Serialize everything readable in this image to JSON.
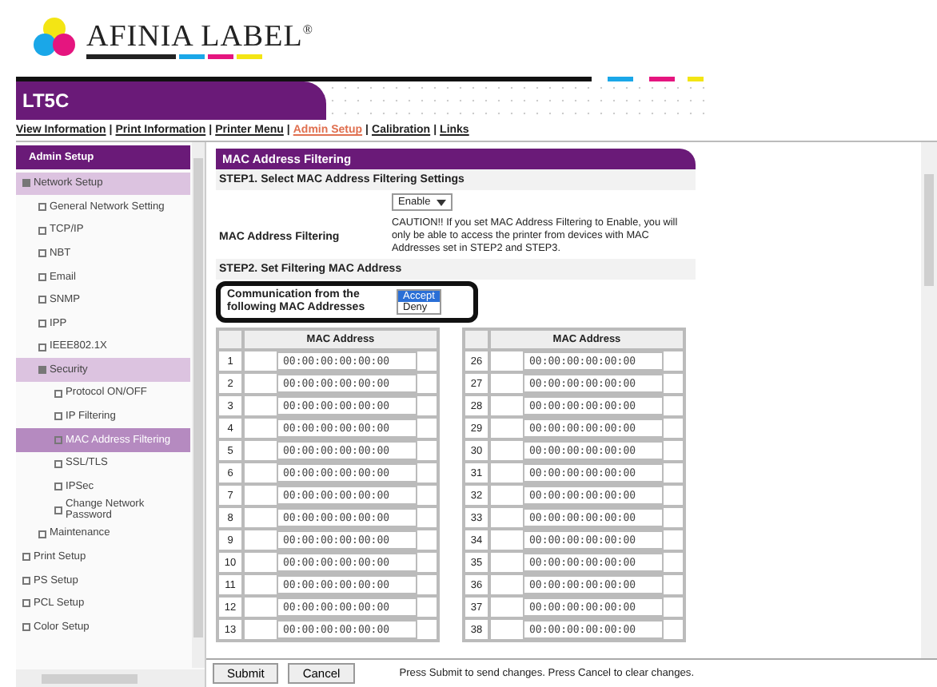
{
  "logo": {
    "text": "AFINIA LABEL$^{®}$"
  },
  "title_bar": {
    "title": "LT5C"
  },
  "nav": {
    "separator": "|",
    "links": [
      {
        "label": "View Information",
        "selected": false
      },
      {
        "label": "Print Information",
        "selected": false
      },
      {
        "label": "Printer Menu",
        "selected": false
      },
      {
        "label": "Admin Setup",
        "selected": true
      },
      {
        "label": "Calibration",
        "selected": false
      },
      {
        "label": "Links",
        "selected": false
      }
    ]
  },
  "sidebar": {
    "items": [
      {
        "label": "Admin Setup",
        "kind": "header",
        "selected": false
      },
      {
        "label": "Network Setup",
        "kind": "folder",
        "expanded": true,
        "selected": false,
        "children": [
          {
            "label": "General Network Setting",
            "kind": "page",
            "selected": false
          },
          {
            "label": "TCP/IP",
            "kind": "page",
            "selected": false
          },
          {
            "label": "NBT",
            "kind": "page",
            "selected": false
          },
          {
            "label": "Email",
            "kind": "folder",
            "expanded": false,
            "selected": false
          },
          {
            "label": "SNMP",
            "kind": "folder",
            "expanded": false,
            "selected": false
          },
          {
            "label": "IPP",
            "kind": "folder",
            "expanded": false,
            "selected": false
          },
          {
            "label": "IEEE802.1X",
            "kind": "page",
            "selected": false
          },
          {
            "label": "Security",
            "kind": "folder",
            "expanded": true,
            "selected": false,
            "children": [
              {
                "label": "Protocol ON/OFF",
                "kind": "page",
                "selected": false
              },
              {
                "label": "IP Filtering",
                "kind": "page",
                "selected": false
              },
              {
                "label": "MAC Address Filtering",
                "kind": "page",
                "selected": true
              },
              {
                "label": "SSL/TLS",
                "kind": "page",
                "selected": false
              },
              {
                "label": "IPSec",
                "kind": "page",
                "selected": false
              },
              {
                "label": "Change Network Password",
                "kind": "page",
                "selected": false
              }
            ]
          },
          {
            "label": "Maintenance",
            "kind": "folder",
            "expanded": false,
            "selected": false
          }
        ]
      },
      {
        "label": "Print Setup",
        "kind": "page",
        "selected": false
      },
      {
        "label": "PS Setup",
        "kind": "page",
        "selected": false
      },
      {
        "label": "PCL Setup",
        "kind": "page",
        "selected": false
      },
      {
        "label": "Color Setup",
        "kind": "page",
        "selected": false
      }
    ]
  },
  "panel": {
    "title": "MAC Address Filtering",
    "step1": "STEP1. Select MAC Address Filtering Settings",
    "filter_select": {
      "value": "Enable"
    },
    "filter_label": "MAC Address Filtering",
    "caution": "CAUTION!! If you set MAC Address Filtering to Enable, you will only be able to access the printer from devices with MAC Addresses set in STEP2 and STEP3.",
    "step2": "STEP2. Set Filtering MAC Address",
    "communication_label": "Communication from the following MAC Addresses",
    "communication_options": [
      {
        "label": "Accept",
        "selected": true
      },
      {
        "label": "Deny",
        "selected": false
      }
    ],
    "tables": [
      {
        "header": "MAC Address",
        "rows": [
          {
            "number": "1",
            "value": "00:00:00:00:00:00"
          },
          {
            "number": "2",
            "value": "00:00:00:00:00:00"
          },
          {
            "number": "3",
            "value": "00:00:00:00:00:00"
          },
          {
            "number": "4",
            "value": "00:00:00:00:00:00"
          },
          {
            "number": "5",
            "value": "00:00:00:00:00:00"
          },
          {
            "number": "6",
            "value": "00:00:00:00:00:00"
          },
          {
            "number": "7",
            "value": "00:00:00:00:00:00"
          },
          {
            "number": "8",
            "value": "00:00:00:00:00:00"
          },
          {
            "number": "9",
            "value": "00:00:00:00:00:00"
          },
          {
            "number": "10",
            "value": "00:00:00:00:00:00"
          },
          {
            "number": "11",
            "value": "00:00:00:00:00:00"
          },
          {
            "number": "12",
            "value": "00:00:00:00:00:00"
          },
          {
            "number": "13",
            "value": "00:00:00:00:00:00"
          }
        ]
      },
      {
        "header": "MAC Address",
        "rows": [
          {
            "number": "26",
            "value": "00:00:00:00:00:00"
          },
          {
            "number": "27",
            "value": "00:00:00:00:00:00"
          },
          {
            "number": "28",
            "value": "00:00:00:00:00:00"
          },
          {
            "number": "29",
            "value": "00:00:00:00:00:00"
          },
          {
            "number": "30",
            "value": "00:00:00:00:00:00"
          },
          {
            "number": "31",
            "value": "00:00:00:00:00:00"
          },
          {
            "number": "32",
            "value": "00:00:00:00:00:00"
          },
          {
            "number": "33",
            "value": "00:00:00:00:00:00"
          },
          {
            "number": "34",
            "value": "00:00:00:00:00:00"
          },
          {
            "number": "35",
            "value": "00:00:00:00:00:00"
          },
          {
            "number": "36",
            "value": "00:00:00:00:00:00"
          },
          {
            "number": "37",
            "value": "00:00:00:00:00:00"
          },
          {
            "number": "38",
            "value": "00:00:00:00:00:00"
          }
        ]
      }
    ]
  },
  "footer": {
    "buttons": [
      "Submit",
      "Cancel"
    ],
    "hint": "Press Submit to send changes. Press Cancel to clear changes."
  }
}
